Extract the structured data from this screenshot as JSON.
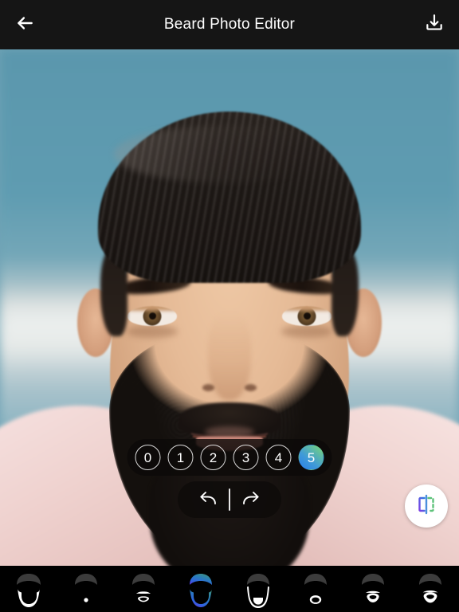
{
  "header": {
    "title": "Beard Photo Editor",
    "back_icon": "arrow-left-icon",
    "save_icon": "download-icon"
  },
  "editor": {
    "intensity": {
      "label": "Beard opacity level",
      "options": [
        "0",
        "1",
        "2",
        "3",
        "4",
        "5"
      ],
      "selected": "5",
      "selected_index": 5
    },
    "history": {
      "undo_label": "Undo",
      "undo_icon": "undo-arrow-icon",
      "redo_label": "Redo",
      "redo_icon": "redo-arrow-icon"
    },
    "compare": {
      "label": "Compare before and after",
      "icon": "before-after-compare-icon"
    }
  },
  "styles": {
    "selected_index": 3,
    "items": [
      {
        "id": "style-0",
        "name": "Full beard with moustache",
        "selected": false
      },
      {
        "id": "style-1",
        "name": "Soul patch",
        "selected": false
      },
      {
        "id": "style-2",
        "name": "Moustache and chin puff",
        "selected": false
      },
      {
        "id": "style-3",
        "name": "Full rounded beard",
        "selected": true
      },
      {
        "id": "style-4",
        "name": "Chin strap outline beard",
        "selected": false
      },
      {
        "id": "style-5",
        "name": "Circle goatee ring",
        "selected": false
      },
      {
        "id": "style-6",
        "name": "Rounded goatee",
        "selected": false
      },
      {
        "id": "style-7",
        "name": "Anchor goatee",
        "selected": false
      }
    ]
  },
  "colors": {
    "header_bg": "#151515",
    "strip_bg": "#000000",
    "accent_start": "#2b7fe8",
    "accent_end": "#7ad877",
    "pill_bg": "rgba(12,10,9,0.82)",
    "compare_left": "#6a3fd6",
    "compare_right": "#53c37a",
    "thumb_fill": "#ffffff",
    "thumb_hair": "#3a3a3a"
  }
}
